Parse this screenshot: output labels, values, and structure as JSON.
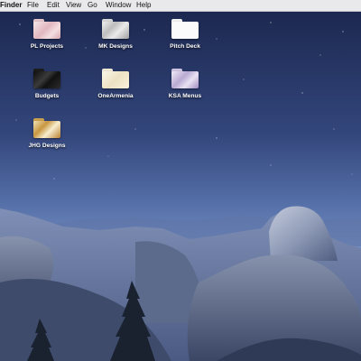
{
  "menubar": {
    "app_name": "Finder",
    "items": [
      "File",
      "Edit",
      "View",
      "Go",
      "Window",
      "Help"
    ]
  },
  "desktop": {
    "icons": [
      {
        "label": "PL Projects",
        "style": "pink-marble"
      },
      {
        "label": "MK Designs",
        "style": "grey-marble"
      },
      {
        "label": "Pitch Deck",
        "style": "white"
      },
      {
        "label": "Budgets",
        "style": "black-marble"
      },
      {
        "label": "OneArmenia",
        "style": "cream"
      },
      {
        "label": "KSA Menus",
        "style": "purple-marble"
      },
      {
        "label": "JHG Designs",
        "style": "gold"
      }
    ]
  },
  "colors": {
    "sky_top": "#1d2a52",
    "sky_mid": "#4a6196",
    "sky_low": "#7c93c4",
    "menubar_bg": "#e9e9ec",
    "rock": "#9aa6bf",
    "shadow": "#2d3a55"
  }
}
